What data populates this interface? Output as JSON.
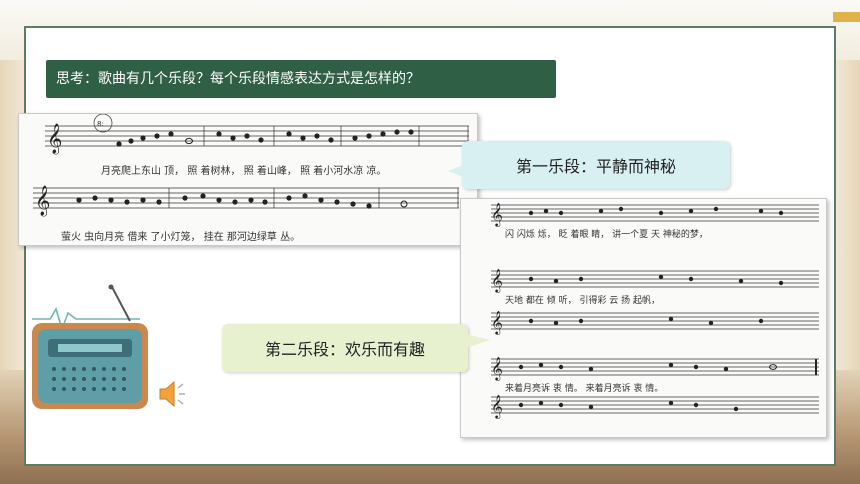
{
  "question": "思考：歌曲有几个乐段？每个乐段情感表达方式是怎样的？",
  "section_1_label": "第一乐段：平静而神秘",
  "section_2_label": "第二乐段：欢乐而有趣",
  "score_top": {
    "tempo_mark": "8:",
    "lyrics_line_1": "月亮爬上东山 顶，   照 着树林， 照 着山峰， 照 着小河水凉 凉。",
    "lyrics_line_2": "萤火 虫向月亮   借来  了小灯笼， 挂在  那河边绿草  丛。"
  },
  "score_right": {
    "lyrics_line_1": "闪  闪烁 烁， 眨  着眼 睛， 讲一个夏 天  神秘的梦，",
    "lyrics_line_2": "天地  都在  倾   听，        引得彩  云       扬   起帆，",
    "lyrics_line_3": "来着月亮诉   衷   情。     来着月亮诉   衷   情。"
  },
  "colors": {
    "question_bg": "#2f5f45",
    "panel_border": "#5b7d63",
    "bubble_1_bg": "#d9f0f3",
    "bubble_2_bg": "#e7f1cf",
    "accent": "#e2b24a"
  },
  "icons": [
    "radio-icon",
    "speaker-icon"
  ]
}
